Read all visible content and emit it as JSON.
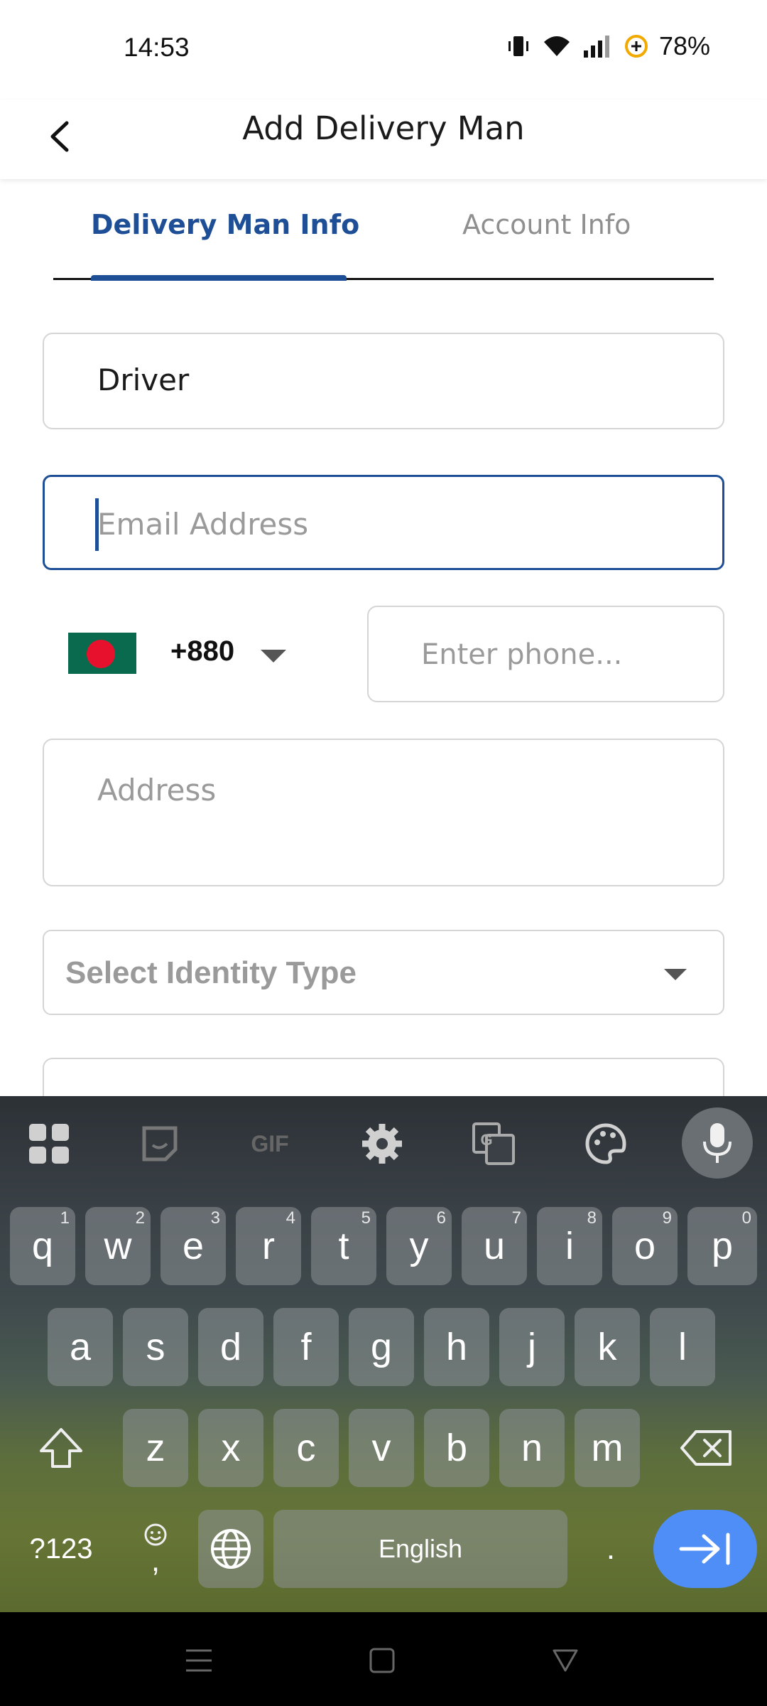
{
  "status_bar": {
    "time": "14:53",
    "battery": "78%"
  },
  "app_bar": {
    "title": "Add Delivery Man"
  },
  "tabs": [
    {
      "label": "Delivery Man Info",
      "active": true
    },
    {
      "label": "Account Info",
      "active": false
    }
  ],
  "form": {
    "name_value": "Driver",
    "email_placeholder": "Email Address",
    "country_code": "+880",
    "phone_placeholder": "Enter phone...",
    "address_placeholder": "Address",
    "identity_placeholder": "Select Identity Type"
  },
  "keyboard": {
    "row1": [
      {
        "key": "q",
        "hint": "1"
      },
      {
        "key": "w",
        "hint": "2"
      },
      {
        "key": "e",
        "hint": "3"
      },
      {
        "key": "r",
        "hint": "4"
      },
      {
        "key": "t",
        "hint": "5"
      },
      {
        "key": "y",
        "hint": "6"
      },
      {
        "key": "u",
        "hint": "7"
      },
      {
        "key": "i",
        "hint": "8"
      },
      {
        "key": "o",
        "hint": "9"
      },
      {
        "key": "p",
        "hint": "0"
      }
    ],
    "row2": [
      "a",
      "s",
      "d",
      "f",
      "g",
      "h",
      "j",
      "k",
      "l"
    ],
    "row3": [
      "z",
      "x",
      "c",
      "v",
      "b",
      "n",
      "m"
    ],
    "symbols_label": "?123",
    "comma_label": ",",
    "space_label": "English",
    "period_label": "."
  },
  "colors": {
    "accent": "#1e4f96",
    "enter_key": "#4f8ef7",
    "flag_green": "#0a6a4e",
    "flag_red": "#e8112d"
  }
}
